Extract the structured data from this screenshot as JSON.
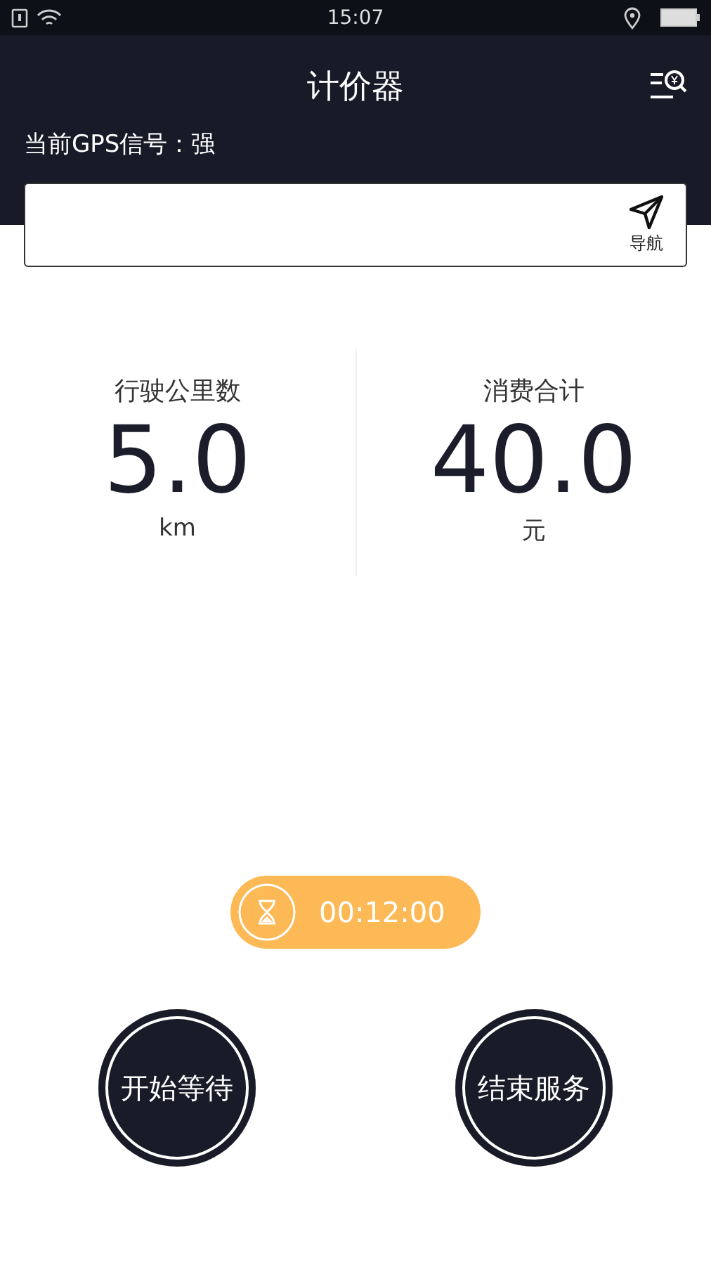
{
  "status_bar": {
    "time": "15:07"
  },
  "header": {
    "title": "计价器",
    "gps_status": "当前GPS信号：强"
  },
  "navigation": {
    "button_label": "导航"
  },
  "stats": [
    {
      "label": "行驶公里数",
      "value": "5.0",
      "unit": "km"
    },
    {
      "label": "消费合计",
      "value": "40.0",
      "unit": "元"
    }
  ],
  "timer": {
    "time": "00:12:00"
  },
  "actions": [
    {
      "label": "开始等待"
    },
    {
      "label": "结束服务"
    }
  ]
}
